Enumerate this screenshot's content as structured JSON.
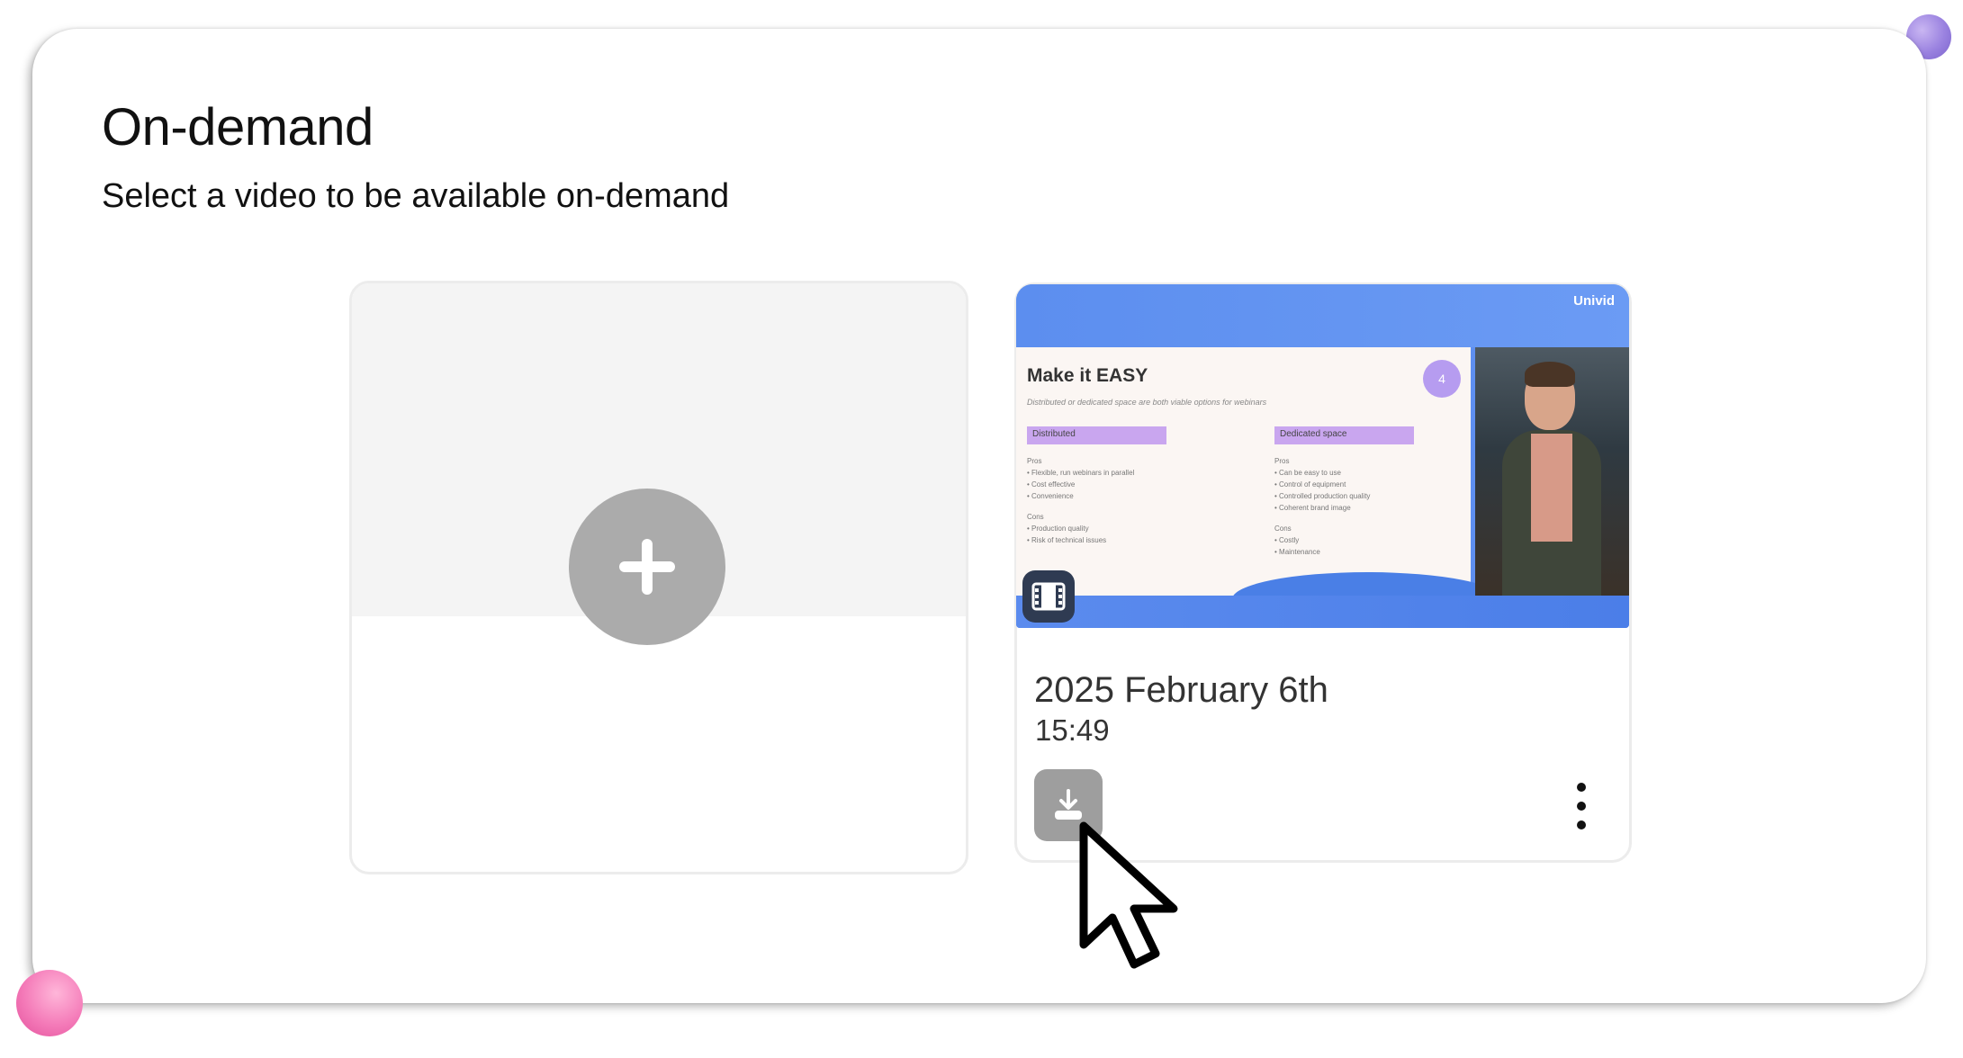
{
  "header": {
    "title": "On-demand",
    "subtitle": "Select a video to be available on-demand"
  },
  "video_card": {
    "date": "2025 February 6th",
    "time": "15:49",
    "thumbnail": {
      "logo": "Univid",
      "slide_title": "Make it EASY",
      "slide_subtitle": "Distributed or dedicated space are both viable options for webinars",
      "badge": "4",
      "col1_head": "Distributed",
      "col1_pros_label": "Pros",
      "col1_pros": [
        "Flexible, run webinars in parallel",
        "Cost effective",
        "Convenience"
      ],
      "col1_cons_label": "Cons",
      "col1_cons": [
        "Production quality",
        "Risk of technical issues"
      ],
      "col2_head": "Dedicated space",
      "col2_pros_label": "Pros",
      "col2_pros": [
        "Can be easy to use",
        "Control of equipment",
        "Controlled production quality",
        "Coherent brand image"
      ],
      "col2_cons_label": "Cons",
      "col2_cons": [
        "Costly",
        "Maintenance"
      ]
    }
  },
  "icons": {
    "add": "plus-icon",
    "film": "film-icon",
    "download": "download-icon",
    "more": "more-vertical-icon",
    "cursor": "mouse-pointer-icon"
  },
  "colors": {
    "accent_blue": "#5e8ff0",
    "add_button": "#ababab",
    "download_button": "#9e9e9e",
    "film_badge": "#2f3b52"
  }
}
